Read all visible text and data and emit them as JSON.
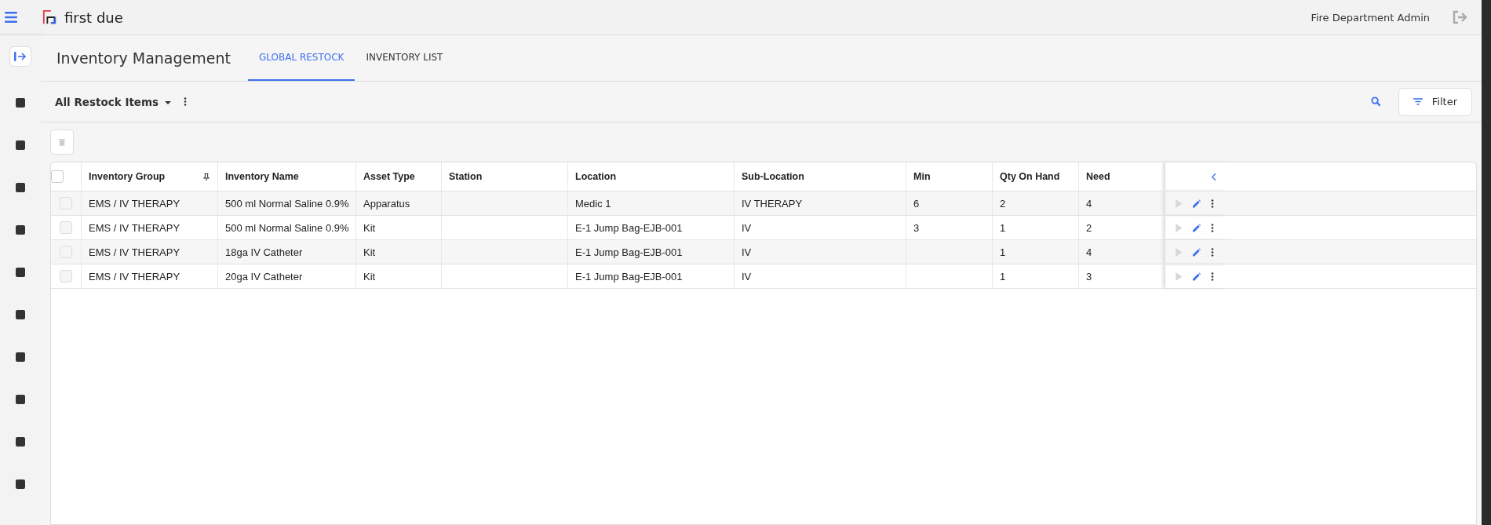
{
  "topbar": {
    "brand": "first due",
    "user": "Fire Department Admin"
  },
  "page": {
    "title": "Inventory Management"
  },
  "tabs": [
    {
      "label": "GLOBAL RESTOCK",
      "selected": true
    },
    {
      "label": "INVENTORY LIST",
      "selected": false
    }
  ],
  "toolbar": {
    "view": "All Restock Items",
    "filter": "Filter"
  },
  "table": {
    "all_checked": false,
    "columns": [
      "Inventory Group",
      "Inventory Name",
      "Asset Type",
      "Station",
      "Location",
      "Sub-Location",
      "Min",
      "Qty On Hand",
      "Need"
    ],
    "rows": [
      {
        "checked": false,
        "cells": [
          "EMS / IV THERAPY",
          "500 ml Normal Saline 0.9%",
          "Apparatus",
          "",
          "Medic 1",
          "IV THERAPY",
          "6",
          "2",
          "4"
        ]
      },
      {
        "checked": false,
        "cells": [
          "EMS / IV THERAPY",
          "500 ml Normal Saline 0.9%",
          "Kit",
          "",
          "E-1 Jump Bag-EJB-001",
          "IV",
          "3",
          "1",
          "2"
        ]
      },
      {
        "checked": false,
        "cells": [
          "EMS / IV THERAPY",
          "18ga IV Catheter",
          "Kit",
          "",
          "E-1 Jump Bag-EJB-001",
          "IV",
          "",
          "1",
          "4"
        ]
      },
      {
        "checked": false,
        "cells": [
          "EMS / IV THERAPY",
          "20ga IV Catheter",
          "Kit",
          "",
          "E-1 Jump Bag-EJB-001",
          "IV",
          "",
          "1",
          "3"
        ]
      }
    ]
  }
}
